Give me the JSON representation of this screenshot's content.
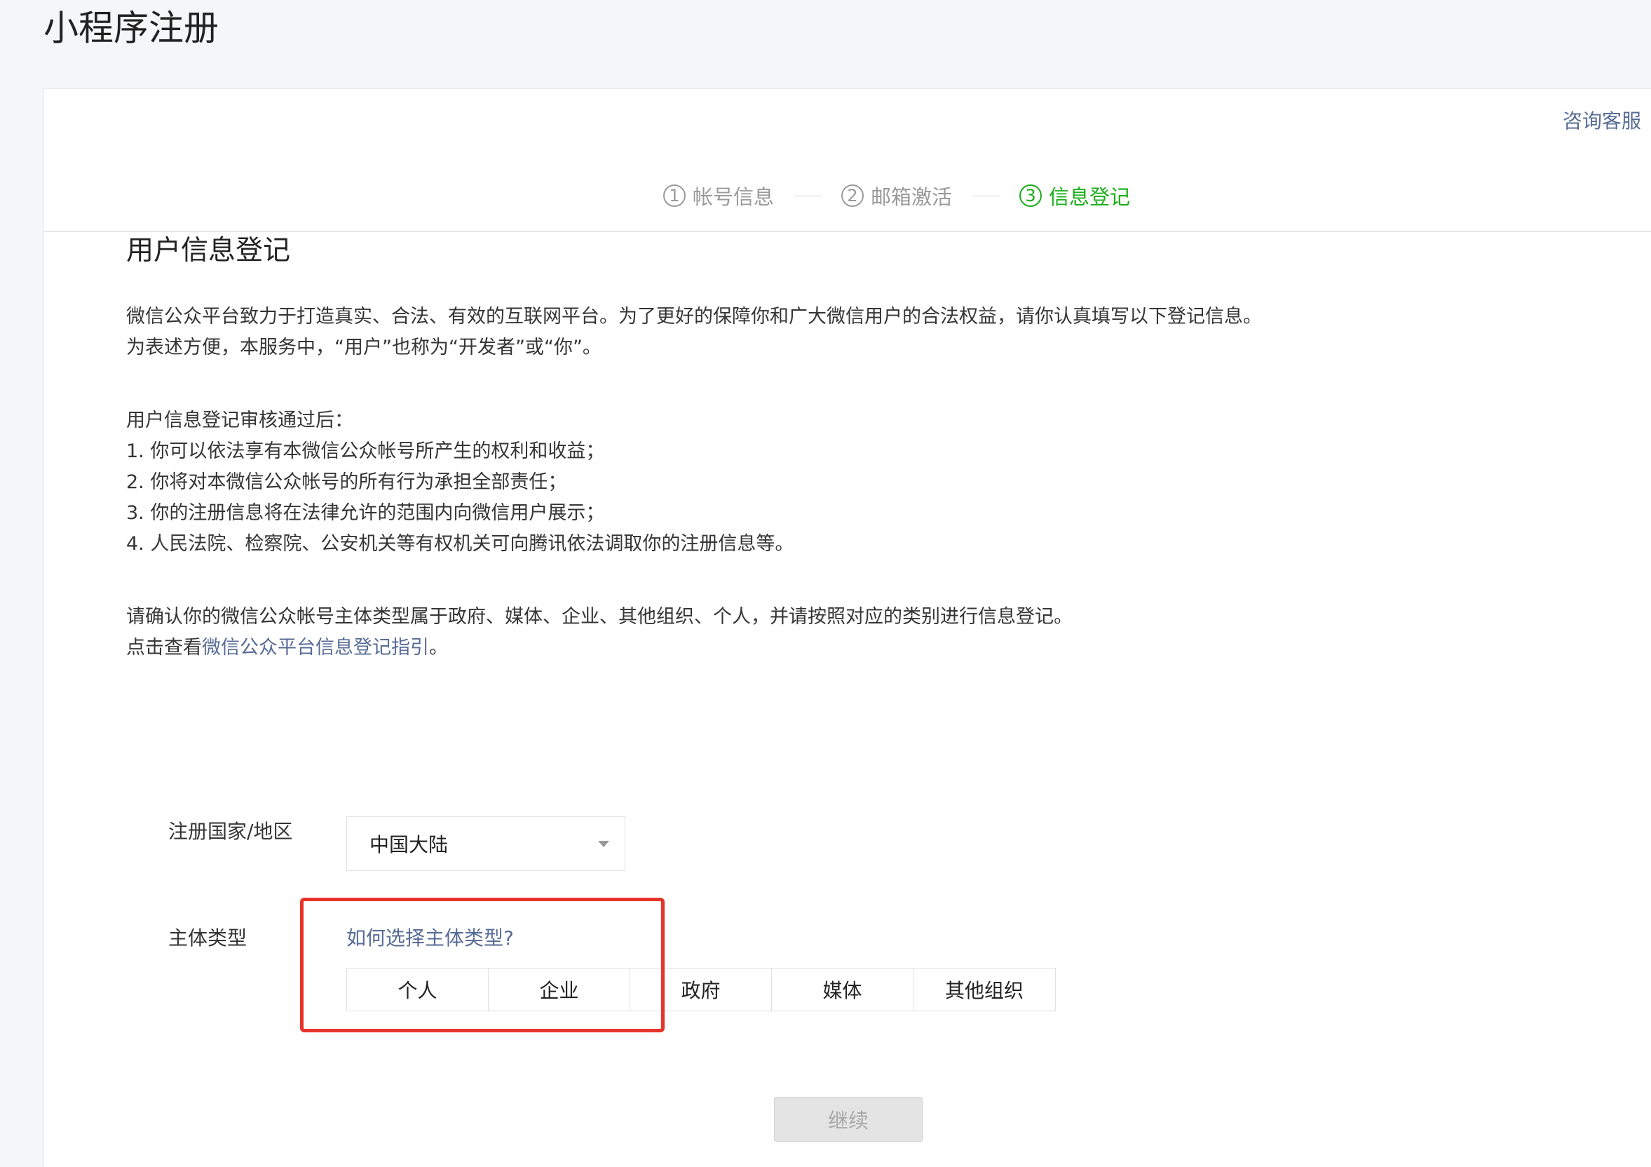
{
  "page": {
    "title": "小程序注册"
  },
  "header": {
    "help_link": "咨询客服"
  },
  "steps": [
    {
      "number": "1",
      "label": "帐号信息",
      "state": "done"
    },
    {
      "number": "2",
      "label": "邮箱激活",
      "state": "done"
    },
    {
      "number": "3",
      "label": "信息登记",
      "state": "active"
    }
  ],
  "content": {
    "section_title": "用户信息登记",
    "intro_line1": "微信公众平台致力于打造真实、合法、有效的互联网平台。为了更好的保障你和广大微信用户的合法权益，请你认真填写以下登记信息。",
    "intro_line2": "为表述方便，本服务中，“用户”也称为“开发者”或“你”。",
    "after_title": "用户信息登记审核通过后：",
    "after_items": [
      "1. 你可以依法享有本微信公众帐号所产生的权利和收益；",
      "2. 你将对本微信公众帐号的所有行为承担全部责任；",
      "3. 你的注册信息将在法律允许的范围内向微信用户展示；",
      "4. 人民法院、检察院、公安机关等有权机关可向腾讯依法调取你的注册信息等。"
    ],
    "confirm_line": "请确认你的微信公众帐号主体类型属于政府、媒体、企业、其他组织、个人，并请按照对应的类别进行信息登记。",
    "guide_prefix": "点击查看",
    "guide_link": "微信公众平台信息登记指引",
    "guide_suffix": "。"
  },
  "form": {
    "region_label": "注册国家/地区",
    "region_value": "中国大陆",
    "type_label": "主体类型",
    "type_help_link": "如何选择主体类型?",
    "type_options": [
      "个人",
      "企业",
      "政府",
      "媒体",
      "其他组织"
    ]
  },
  "actions": {
    "continue_label": "继续"
  },
  "colors": {
    "accent_green": "#1aad19",
    "link_blue": "#576b95",
    "highlight_red": "#e8332b"
  }
}
